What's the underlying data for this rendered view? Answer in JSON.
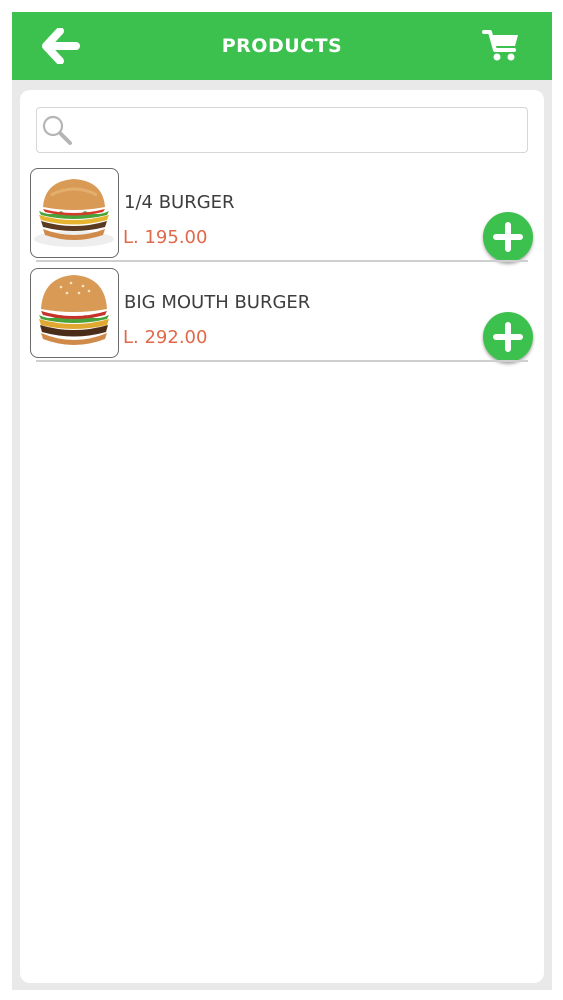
{
  "header": {
    "title": "PRODUCTS",
    "back_icon": "arrow-left-icon",
    "cart_icon": "shopping-cart-icon",
    "color": "#3cc14e"
  },
  "search": {
    "placeholder": "",
    "value": "",
    "icon": "search-icon"
  },
  "products": [
    {
      "name": "1/4 BURGER",
      "price": "L. 195.00",
      "image": "burger-image"
    },
    {
      "name": "BIG MOUTH BURGER",
      "price": "L. 292.00",
      "image": "burger-image"
    }
  ],
  "colors": {
    "accent": "#3cc14e",
    "price": "#e0694a",
    "text": "#3e3e3e"
  }
}
